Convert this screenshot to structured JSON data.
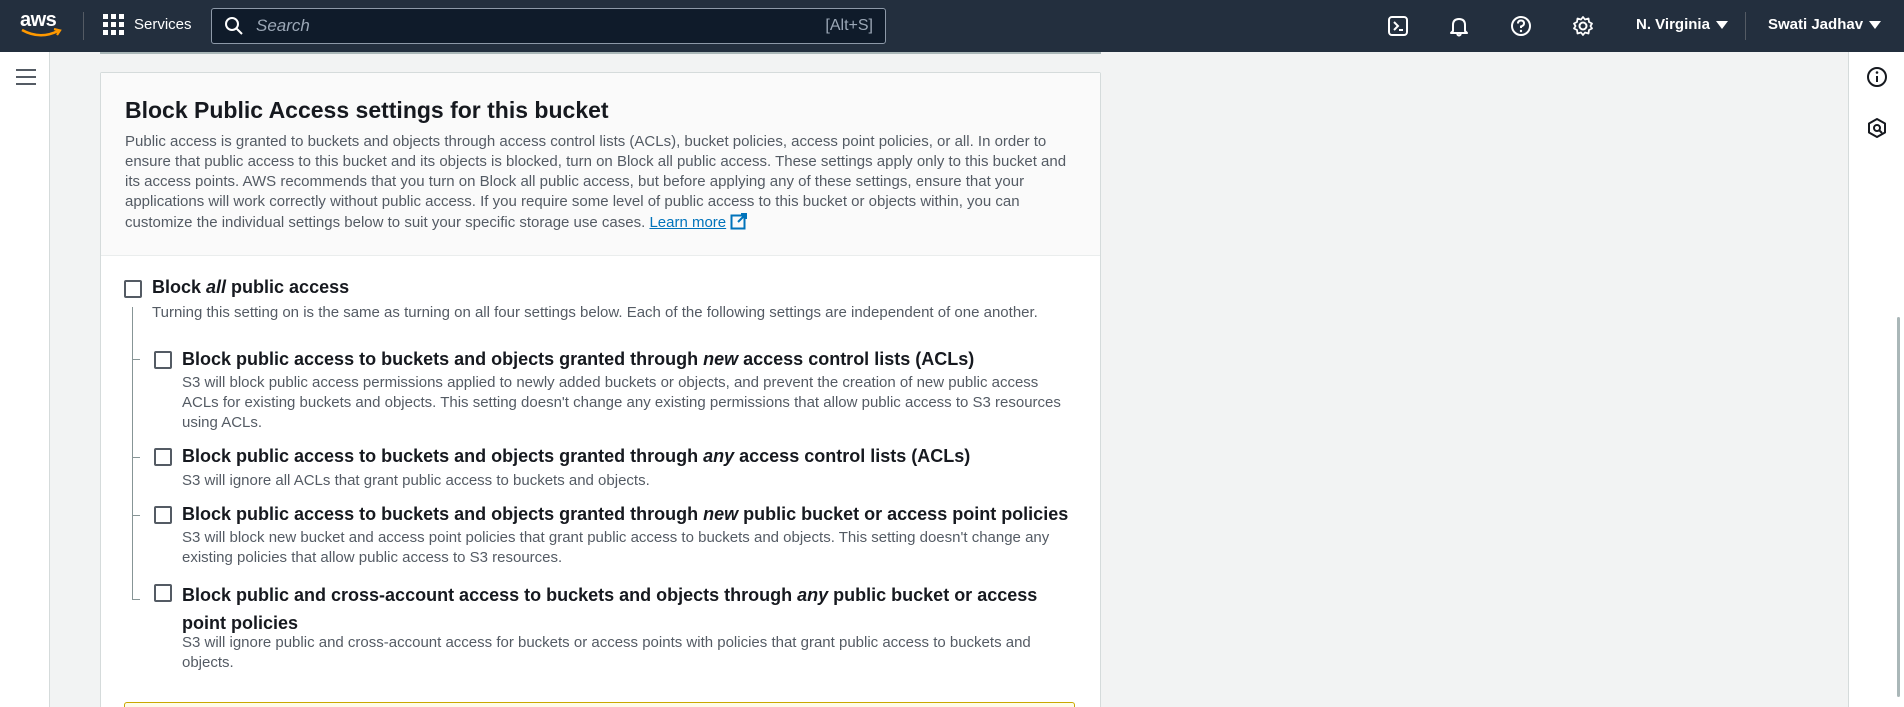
{
  "nav": {
    "logo_text": "aws",
    "services_label": "Services",
    "search_placeholder": "Search",
    "search_shortcut": "[Alt+S]",
    "region": "N. Virginia",
    "user": "Swati Jadhav",
    "icons": [
      "cloudshell-icon",
      "notifications-icon",
      "help-icon",
      "settings-icon"
    ]
  },
  "panel": {
    "title": "Block Public Access settings for this bucket",
    "description": "Public access is granted to buckets and objects through access control lists (ACLs), bucket policies, access point policies, or all. In order to ensure that public access to this bucket and its objects is blocked, turn on Block all public access. These settings apply only to this bucket and its access points. AWS recommends that you turn on Block all public access, but before applying any of these settings, ensure that your applications will work correctly without public access. If you require some level of public access to this bucket or objects within, you can customize the individual settings below to suit your specific storage use cases.",
    "learn_more": "Learn more"
  },
  "block_all": {
    "title_pre": "Block ",
    "title_em": "all",
    "title_post": " public access",
    "description": "Turning this setting on is the same as turning on all four settings below. Each of the following settings are independent of one another.",
    "checked": false
  },
  "options": [
    {
      "title_pre": "Block public access to buckets and objects granted through ",
      "title_em": "new",
      "title_post": " access control lists (ACLs)",
      "description": "S3 will block public access permissions applied to newly added buckets or objects, and prevent the creation of new public access ACLs for existing buckets and objects. This setting doesn't change any existing permissions that allow public access to S3 resources using ACLs.",
      "checked": false
    },
    {
      "title_pre": "Block public access to buckets and objects granted through ",
      "title_em": "any",
      "title_post": " access control lists (ACLs)",
      "description": "S3 will ignore all ACLs that grant public access to buckets and objects.",
      "checked": false
    },
    {
      "title_pre": "Block public access to buckets and objects granted through ",
      "title_em": "new",
      "title_post": " public bucket or access point policies",
      "description": "S3 will block new bucket and access point policies that grant public access to buckets and objects. This setting doesn't change any existing policies that allow public access to S3 resources.",
      "checked": false
    },
    {
      "title_pre": "Block public and cross-account access to buckets and objects through ",
      "title_em": "any",
      "title_post": " public bucket or access point policies",
      "description": "S3 will ignore public and cross-account access for buckets or access points with policies that grant public access to buckets and objects.",
      "checked": false
    }
  ],
  "colors": {
    "nav_bg": "#232f3e",
    "link": "#0073bb",
    "text": "#16191f",
    "muted": "#545b64"
  }
}
